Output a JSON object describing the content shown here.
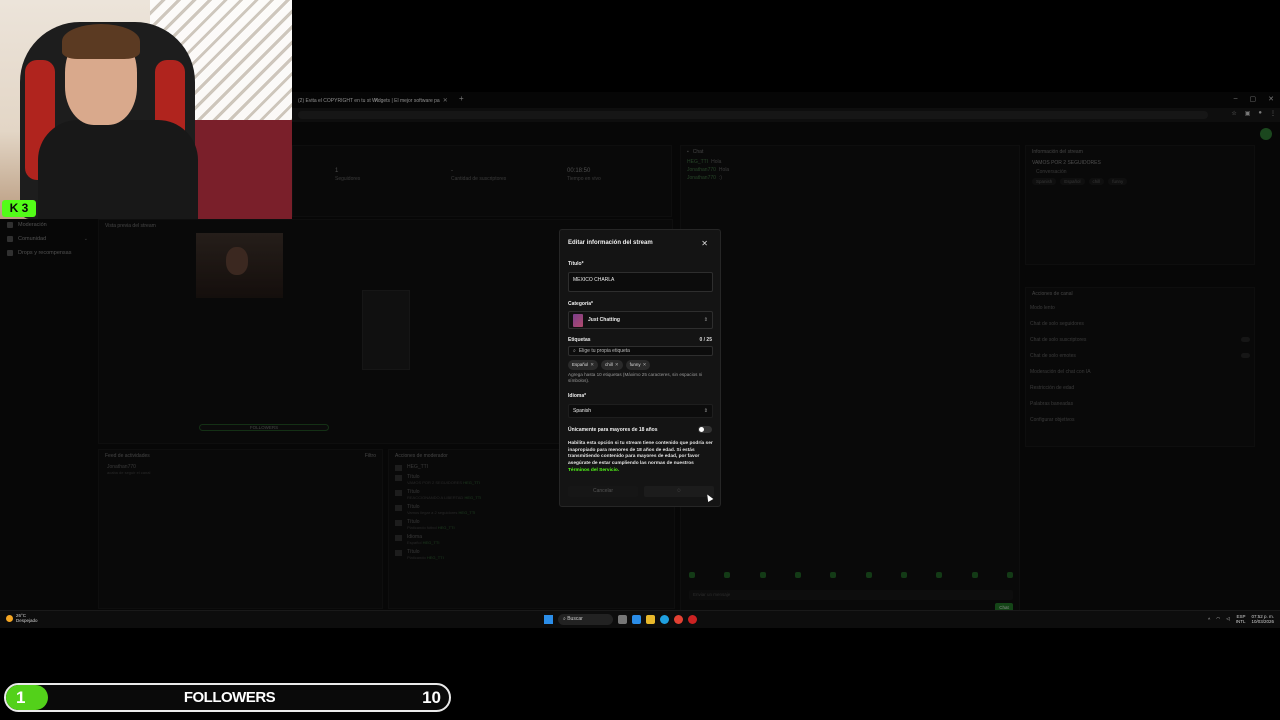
{
  "browser": {
    "tabs": [
      {
        "label": "(2) Evita el COPYRIGHT en tu st"
      },
      {
        "label": "Widgets | El mejor software pa"
      }
    ]
  },
  "sidebar": {
    "items": [
      {
        "label": "Moderación"
      },
      {
        "label": "Comunidad"
      },
      {
        "label": "Drops y recompensas"
      }
    ]
  },
  "stats": [
    {
      "value": "1",
      "label": "Seguidores"
    },
    {
      "value": "-",
      "label": "Cantidad de suscriptores"
    },
    {
      "value": "00:18:50",
      "label": "Tiempo en vivo"
    }
  ],
  "chat": {
    "title": "Chat",
    "messages": [
      {
        "user": "HEG_TTI",
        "text": "Hola"
      },
      {
        "user": "Jonathan770",
        "text": "Hola"
      },
      {
        "user": "Jonathan770",
        "text": ":)"
      }
    ],
    "input_placeholder": "Enviar un mensaje",
    "send_label": "Chat"
  },
  "stream_info": {
    "title": "Información del stream",
    "stream_title": "VAMOS POR 2 SEGUIDORES",
    "category": "Conversación",
    "tags": [
      "Spanish",
      "Español",
      "chill",
      "funny"
    ]
  },
  "channel_actions": {
    "title": "Acciones de canal",
    "rows": [
      "Modo lento",
      "Chat de solo seguidores",
      "Chat de solo suscriptores",
      "Chat de solo emotes",
      "Moderación del chat con IA",
      "Restricción de edad",
      "Palabras baneadas",
      "Configurar objetivos"
    ]
  },
  "preview": {
    "title": "Vista previa del stream",
    "bar_label": "FOLLOWERS"
  },
  "feed": {
    "title": "Feed de actividades",
    "filter": "Filtro",
    "items": [
      {
        "user": "Jonathan770",
        "text": "acaba de seguir el canal"
      }
    ]
  },
  "mod_actions": {
    "title": "Acciones de moderador",
    "rows": [
      {
        "title": "HEG_TTI",
        "detail": "",
        "by": ""
      },
      {
        "title": "Título",
        "detail": "VAMOS POR 2 SEGUIDORES",
        "by": "HEG_TTI"
      },
      {
        "title": "Título",
        "detail": "REACCIONANDO A LIBERTAD",
        "by": "HEG_TTI"
      },
      {
        "title": "Título",
        "detail": "Vamos llegar a 2 seguidores",
        "by": "HEG_TTI"
      },
      {
        "title": "Título",
        "detail": "Platicando fútbol",
        "by": "HEG_TTI"
      },
      {
        "title": "Idioma",
        "detail": "Español",
        "by": "HEG_TTI"
      },
      {
        "title": "Título",
        "detail": "Platicando",
        "by": "HEG_TTI"
      }
    ]
  },
  "modal": {
    "title": "Editar información del stream",
    "title_label": "Título*",
    "title_value": "MEXICO CHARLA",
    "category_label": "Categoría*",
    "category_value": "Just Chatting",
    "tags_label": "Etiquetas",
    "tags_count": "0 / 25",
    "tags_placeholder": "Elige tu propia etiqueta",
    "chips": [
      "Español",
      "chill",
      "funny"
    ],
    "tags_hint": "Agrega hasta 10 etiquetas (Máximo 25 caracteres, sin espacios ni símbolos).",
    "language_label": "Idioma*",
    "language_value": "Spanish",
    "adult_label": "Únicamente para mayores de 18 años",
    "adult_enabled": false,
    "warning_text": "Habilita esta opción si tu stream tiene contenido que podría ser inapropiado para menores de 18 años de edad. Si estás transmitiendo contenido para mayores de edad, por favor asegúrate de estar cumpliendo las normas de nuestros",
    "terms_link": "Términos del Servicio.",
    "cancel_label": "Cancelar"
  },
  "webcam": {
    "badge_letter": "K",
    "badge_number": "3"
  },
  "taskbar": {
    "weather_temp": "26°C",
    "weather_desc": "Despejado",
    "search_label": "Buscar",
    "lang_top": "ESP",
    "lang_bottom": "INTL",
    "time": "07:52 p. m.",
    "date": "10/03/2026"
  },
  "followers_goal": {
    "current": "1",
    "label": "FOLLOWERS",
    "target": "10"
  },
  "colors": {
    "accent": "#53fc18",
    "goal_green": "#53d11a"
  }
}
